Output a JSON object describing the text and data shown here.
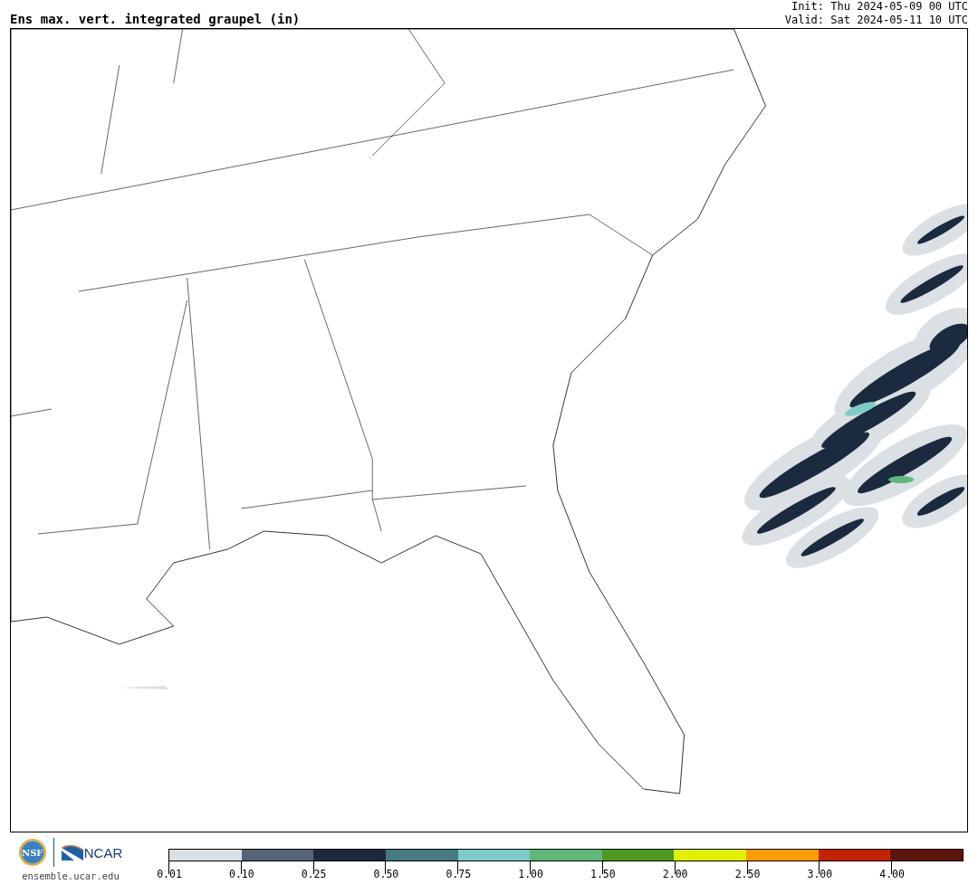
{
  "header": {
    "title": "Ens max. vert. integrated graupel (in)",
    "init": "Init: Thu 2024-05-09 00 UTC",
    "valid": "Valid: Sat 2024-05-11 10 UTC"
  },
  "footer": {
    "nsf_logo": "NSF",
    "ncar_logo": "NCAR",
    "site": "ensemble.ucar.edu"
  },
  "colorbar": [
    {
      "label": "0.01",
      "color": "#dbe0e4"
    },
    {
      "label": "0.10",
      "color": "#566577"
    },
    {
      "label": "0.25",
      "color": "#1c2a40"
    },
    {
      "label": "0.50",
      "color": "#457a7f"
    },
    {
      "label": "0.75",
      "color": "#7ecbc7"
    },
    {
      "label": "1.00",
      "color": "#5fb87a"
    },
    {
      "label": "1.50",
      "color": "#4c9a1e"
    },
    {
      "label": "2.00",
      "color": "#e1ef00"
    },
    {
      "label": "2.50",
      "color": "#fd9d00"
    },
    {
      "label": "3.00",
      "color": "#c42300"
    },
    {
      "label": "4.00",
      "color": "#5e140a"
    }
  ]
}
